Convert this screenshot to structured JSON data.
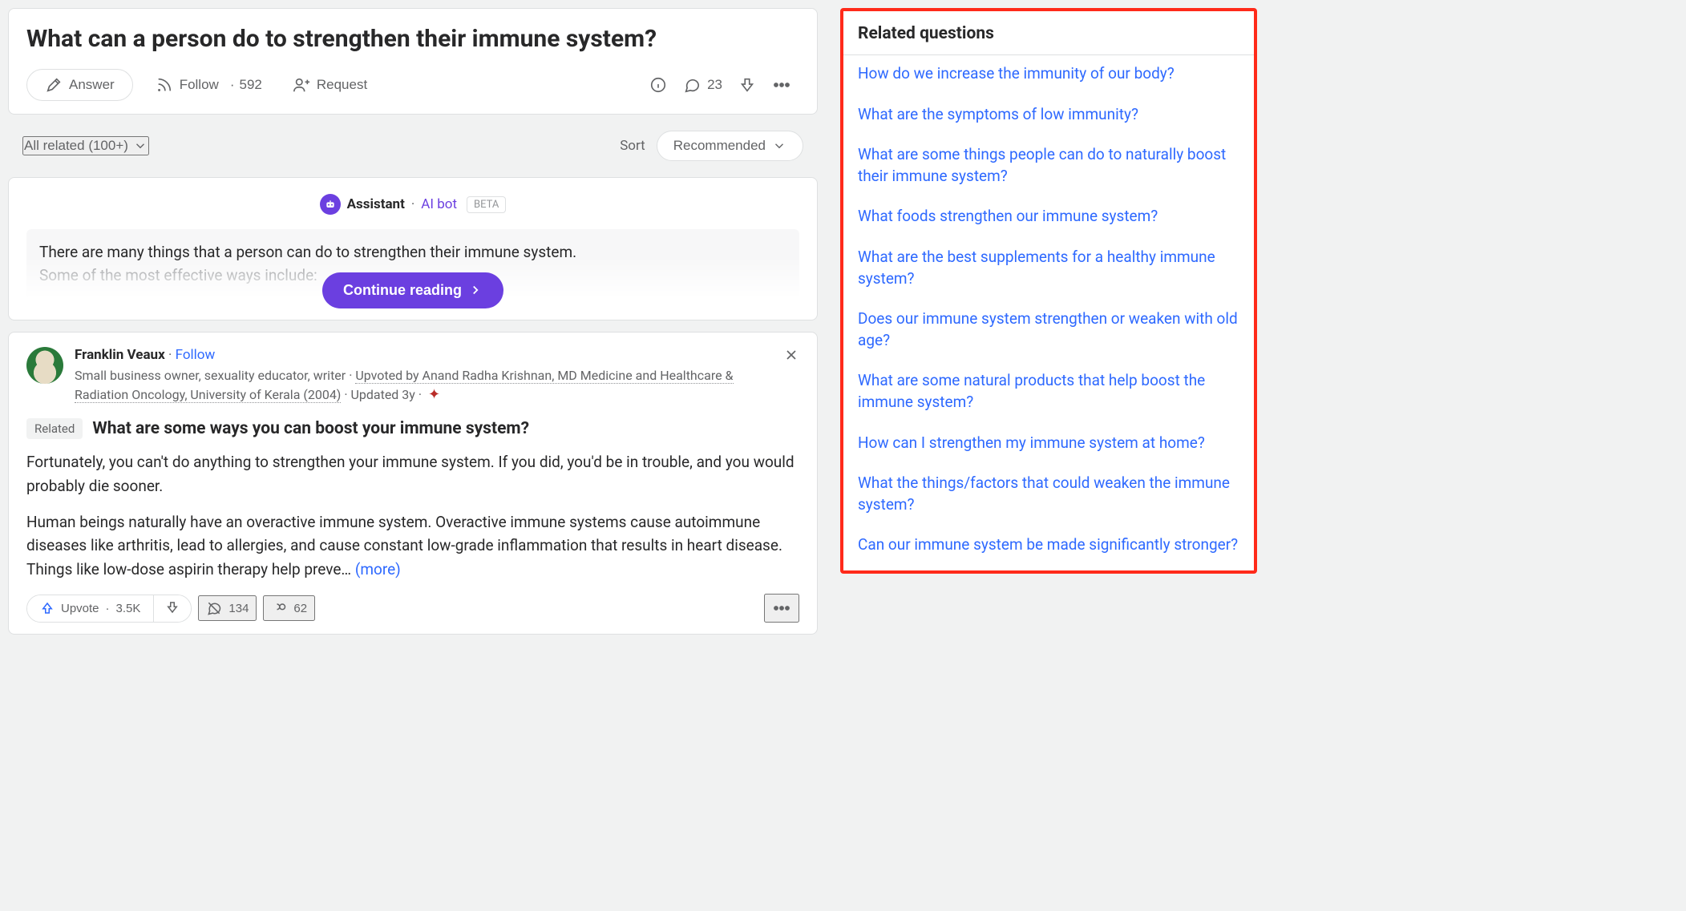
{
  "question": {
    "title": "What can a person do to strengthen their immune system?",
    "answer_label": "Answer",
    "follow_label": "Follow",
    "follow_count": "592",
    "request_label": "Request",
    "comment_count": "23"
  },
  "filter": {
    "all_related": "All related (100+)",
    "sort_label": "Sort",
    "sort_value": "Recommended"
  },
  "assistant": {
    "name": "Assistant",
    "bot_label": "AI bot",
    "beta": "BETA",
    "snippet_line1": "There are many things that a person can do to strengthen their immune system.",
    "snippet_line2": "Some of the most effective ways include:",
    "continue_label": "Continue reading"
  },
  "answer": {
    "author": "Franklin Veaux",
    "follow": "Follow",
    "bio_prefix": "Small business owner, sexuality educator, writer",
    "upvoted_by": "Upvoted by Anand Radha Krishnan, MD Medicine and Healthcare & Radiation Oncology, University of Kerala (2004)",
    "updated": "Updated 3y",
    "related_tag": "Related",
    "related_q": "What are some ways you can boost your immune system?",
    "p1": "Fortunately, you can't do anything to strengthen your immune system. If you did, you'd be in trouble, and you would probably die sooner.",
    "p2": "Human beings naturally have an overactive immune system. Overactive immune systems cause autoimmune diseases like arthritis, lead to allergies, and cause constant low-grade inflammation that results in heart disease. Things like low-dose aspirin therapy help preve…",
    "more": "(more)",
    "upvote_label": "Upvote",
    "upvote_count": "3.5K",
    "comment_count": "134",
    "share_count": "62"
  },
  "sidebar": {
    "title": "Related questions",
    "items": [
      "How do we increase the immunity of our body?",
      "What are the symptoms of low immunity?",
      "What are some things people can do to naturally boost their immune system?",
      "What foods strengthen our immune system?",
      "What are the best supplements for a healthy immune system?",
      "Does our immune system strengthen or weaken with old age?",
      "What are some natural products that help boost the immune system?",
      "How can I strengthen my immune system at home?",
      "What the things/factors that could weaken the immune system?",
      "Can our immune system be made significantly stronger?"
    ]
  }
}
